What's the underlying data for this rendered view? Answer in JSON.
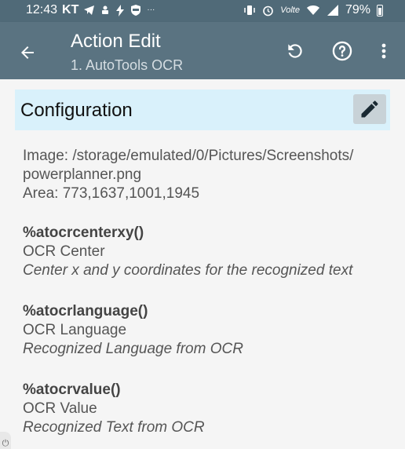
{
  "status_bar": {
    "time": "12:43",
    "carrier": "KT",
    "lte": "Volte",
    "battery": "79%"
  },
  "app_bar": {
    "title": "Action Edit",
    "subtitle": "1. AutoTools OCR"
  },
  "configuration": {
    "header": "Configuration",
    "image_line": "Image: /storage/emulated/0/Pictures/Screenshots/",
    "image_line_2": "powerplanner.png",
    "area_line": "Area: 773,1637,1001,1945",
    "variables": [
      {
        "name": "%atocrcenterxy()",
        "label": "OCR Center",
        "description": "Center x and y coordinates for the recognized text"
      },
      {
        "name": "%atocrlanguage()",
        "label": "OCR Language",
        "description": "Recognized Language from OCR"
      },
      {
        "name": "%atocrvalue()",
        "label": "OCR Value",
        "description": "Recognized Text from OCR"
      }
    ]
  },
  "colors": {
    "app_bar": "#5a7381",
    "status_bar": "#506a78",
    "config_header_bg": "#d9f1fb"
  }
}
